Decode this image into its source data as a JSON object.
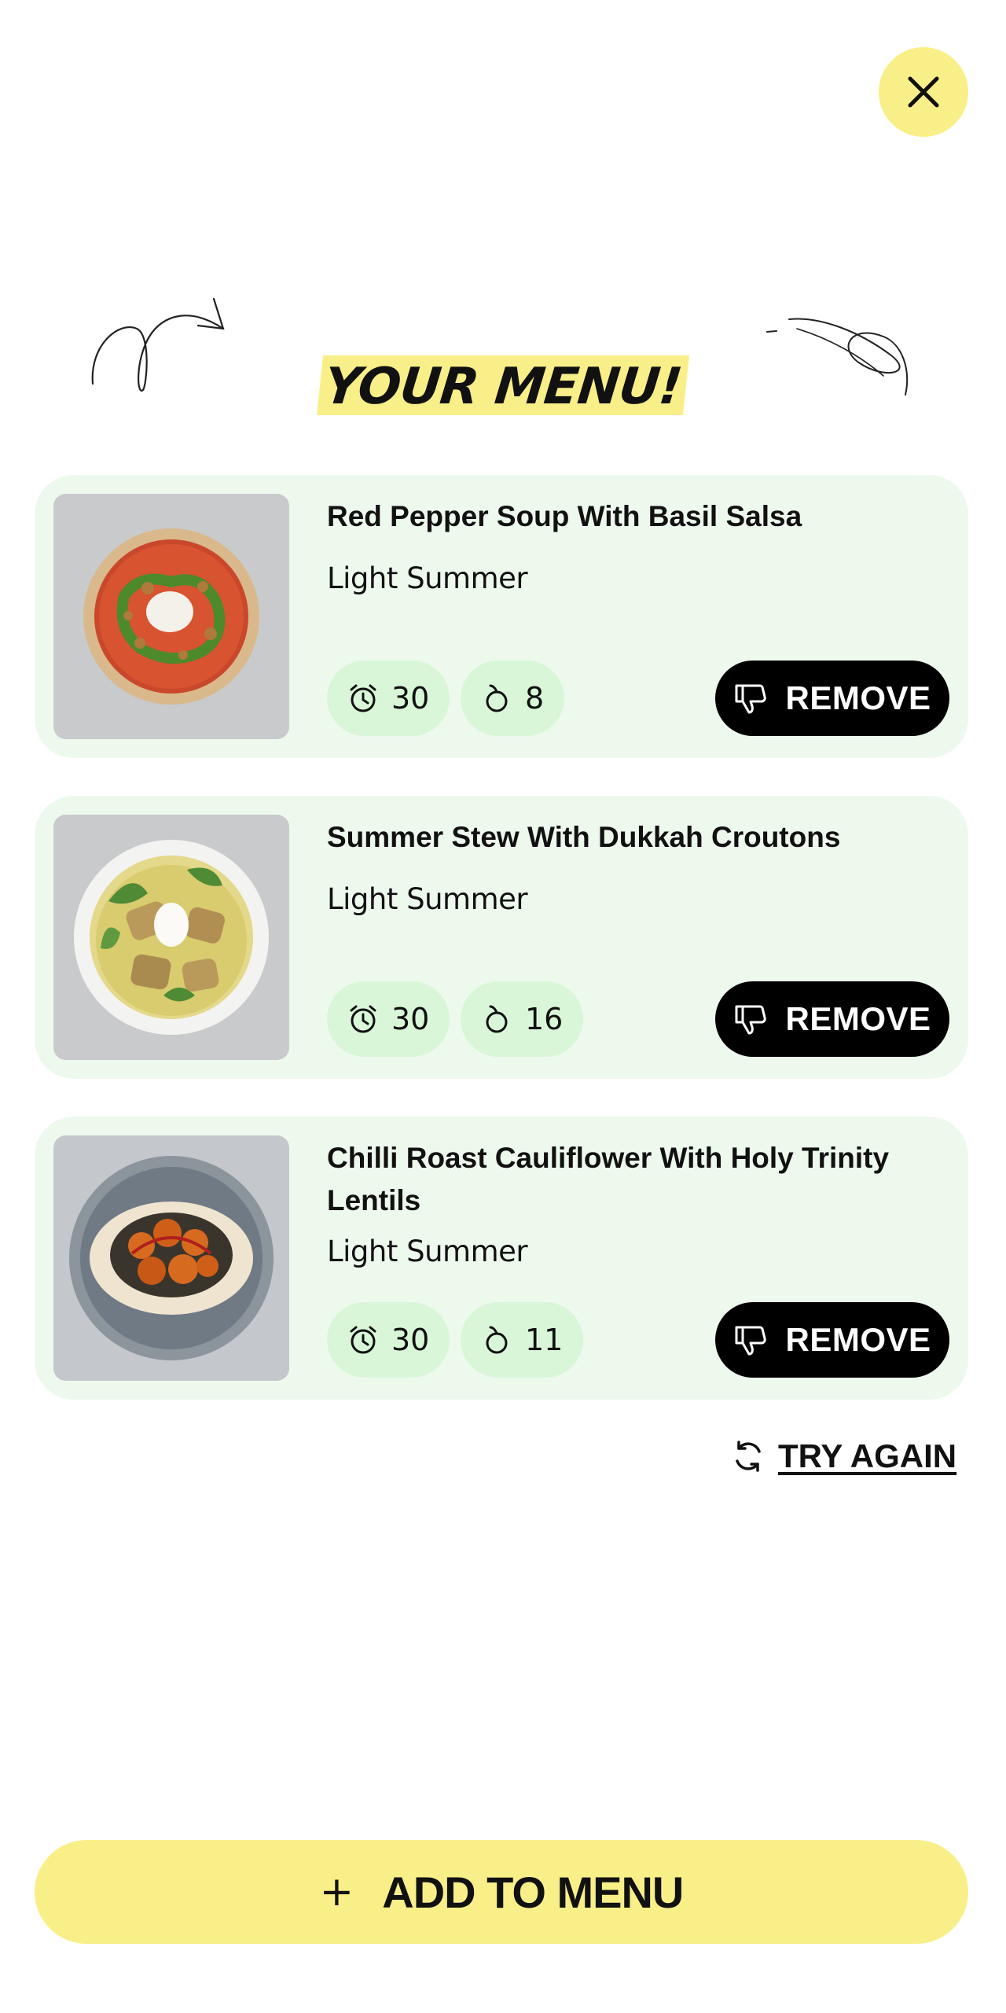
{
  "header": {
    "close_icon": "close-icon",
    "title": "YOUR MENU!"
  },
  "colors": {
    "accent_yellow": "#f9ef88",
    "card_bg": "#eef9ee",
    "pill_bg": "#d9f6d9",
    "button_black": "#000000"
  },
  "recipes": [
    {
      "title": "Red Pepper Soup With Basil Salsa",
      "subtitle": "Light Summer",
      "time": "30",
      "time_icon": "alarm-clock-icon",
      "ingredients": "8",
      "ingredients_icon": "produce-icon",
      "remove_label": "REMOVE",
      "remove_icon": "thumbs-down-icon"
    },
    {
      "title": "Summer Stew With Dukkah Croutons",
      "subtitle": "Light Summer",
      "time": "30",
      "time_icon": "alarm-clock-icon",
      "ingredients": "16",
      "ingredients_icon": "produce-icon",
      "remove_label": "REMOVE",
      "remove_icon": "thumbs-down-icon"
    },
    {
      "title": "Chilli Roast Cauliflower With Holy Trinity Lentils",
      "subtitle": "Light Summer",
      "time": "30",
      "time_icon": "alarm-clock-icon",
      "ingredients": "11",
      "ingredients_icon": "produce-icon",
      "remove_label": "REMOVE",
      "remove_icon": "thumbs-down-icon"
    }
  ],
  "try_again": {
    "label": "TRY AGAIN",
    "icon": "refresh-icon"
  },
  "footer": {
    "add_label": "ADD TO MENU",
    "add_symbol": "+"
  }
}
